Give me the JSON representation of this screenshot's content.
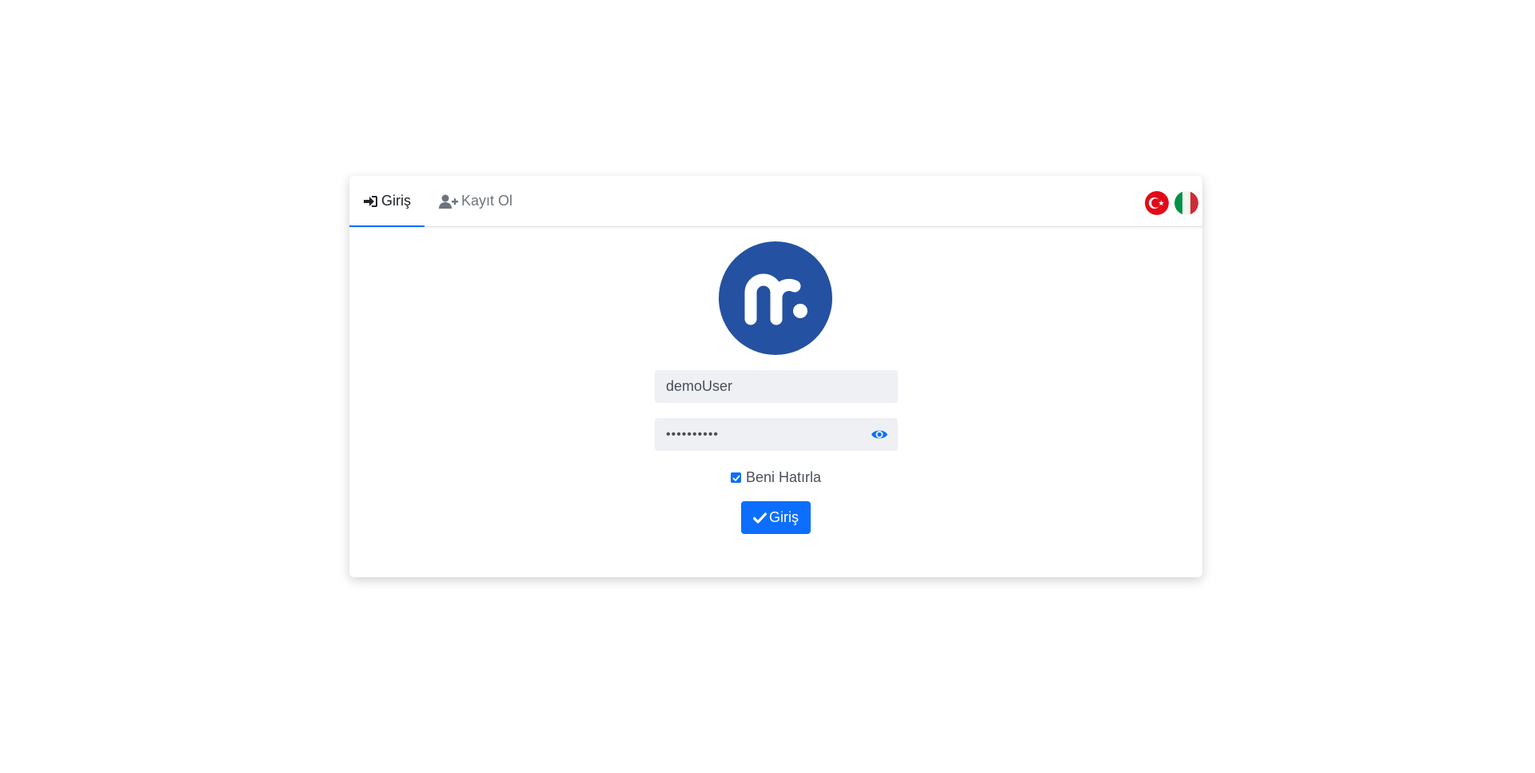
{
  "tabs": {
    "login_label": "Giriş",
    "register_label": "Kayıt Ol"
  },
  "languages": [
    "turkish-flag-icon",
    "italian-flag-icon"
  ],
  "logo": {
    "icon": "mr-logo-icon",
    "color": "#2451a1"
  },
  "form": {
    "username_value": "demoUser",
    "password_value": "••••••••••",
    "remember_label": "Beni Hatırla",
    "remember_checked": true,
    "submit_label": "Giriş"
  },
  "colors": {
    "accent": "#0d6efd",
    "field_bg": "#eef0f4",
    "logo_bg": "#2451a1"
  }
}
